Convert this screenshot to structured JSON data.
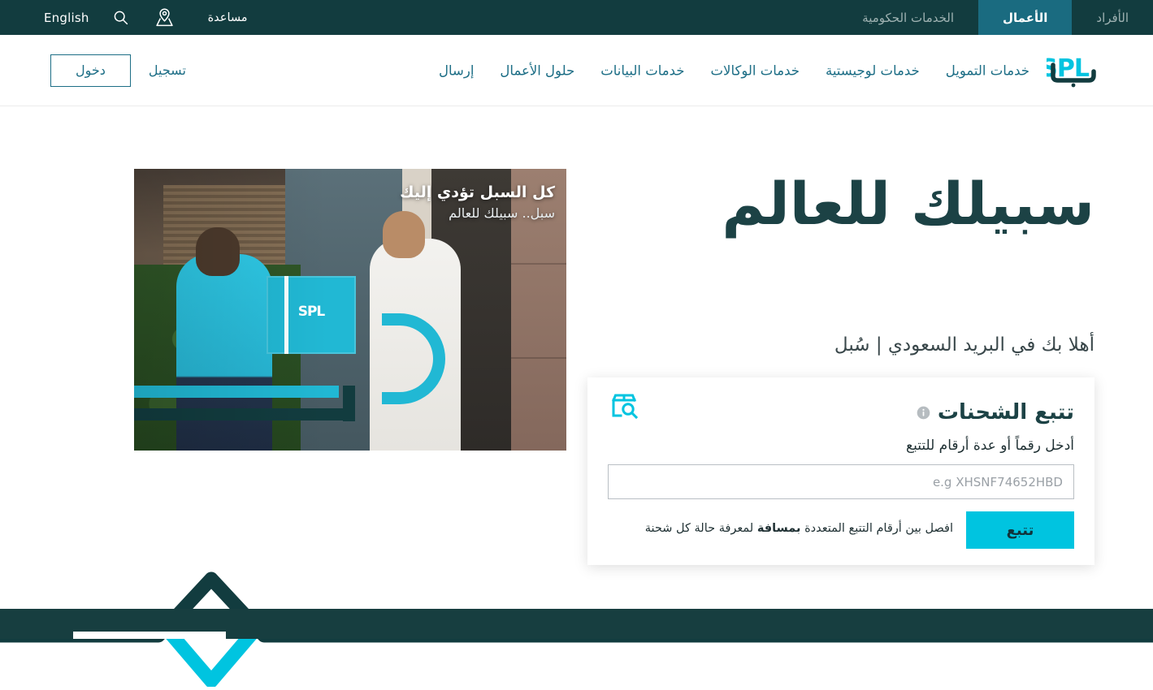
{
  "topbar": {
    "language": "English",
    "search_icon": "search-icon",
    "location_icon": "map-pin-icon",
    "help": "مساعدة",
    "tabs": [
      {
        "label": "الخدمات الحكومية",
        "active": false
      },
      {
        "label": "الأعمال",
        "active": true
      },
      {
        "label": "الأفراد",
        "active": false
      }
    ]
  },
  "nav": {
    "logo_text": "SPL",
    "logo_text_ar": "سبل",
    "links": [
      {
        "label": "خدمات التمويل"
      },
      {
        "label": "خدمات لوجيستية"
      },
      {
        "label": "خدمات الوكالات"
      },
      {
        "label": "خدمات البيانات"
      },
      {
        "label": "حلول الأعمال"
      },
      {
        "label": "إرسال"
      }
    ],
    "login_label": "دخول",
    "register_label": "تسجيل"
  },
  "hero": {
    "title": "سبيلك للعالم",
    "subtitle": "أهلا بك في البريد السعودي | سُبل",
    "photo_caption_primary": "كل السبل تؤدي إليك",
    "photo_caption_secondary": "سبل.. سبيلك للعالم",
    "photo_box_logo": "SPL"
  },
  "track_card": {
    "icon": "package-search-icon",
    "title": "تتبع الشحنات",
    "info_icon": "info-icon",
    "label": "أدخل رقماً أو عدة أرقام للتتبع",
    "input_value": "",
    "input_placeholder": "e.g XHSNF74652HBD",
    "button_label": "تتبع",
    "hint_prefix": "افصل بين أرقام التتبع المتعددة ",
    "hint_bold": "بمسافة",
    "hint_suffix": " لمعرفة حالة كل شحنة"
  },
  "colors": {
    "dark_teal": "#123c3f",
    "active_tab_teal": "#1a6b80",
    "link_teal": "#1d6e86",
    "cyan": "#00c4e0",
    "heading_dark": "#1c4245",
    "footer_teal": "#173e40"
  }
}
